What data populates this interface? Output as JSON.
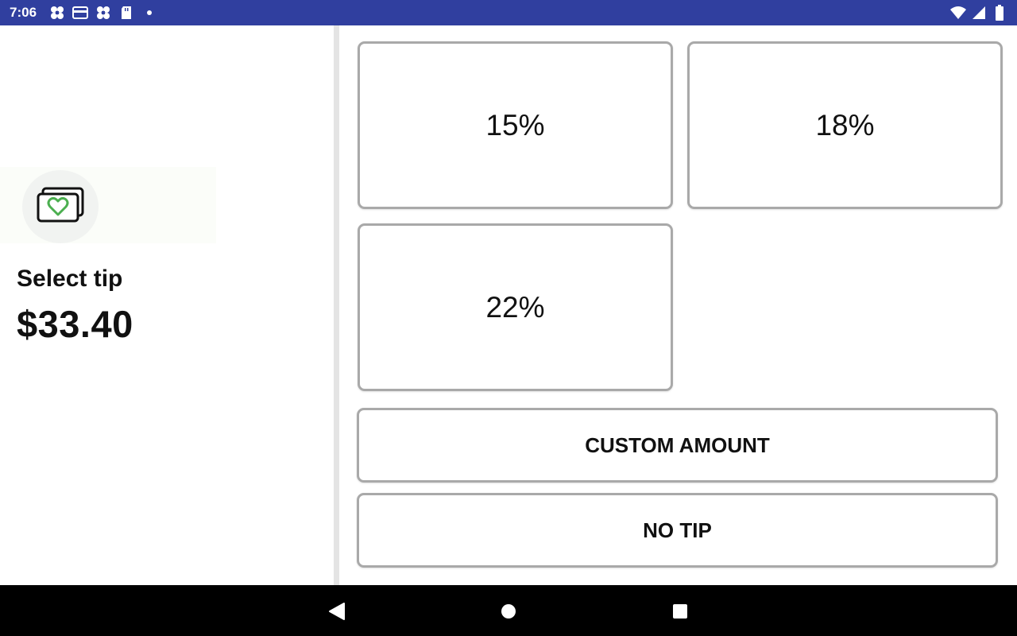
{
  "status_bar": {
    "time": "7:06",
    "left_icons": [
      "app-icon",
      "card-icon",
      "app-icon",
      "sd-card-icon",
      "dot-icon"
    ],
    "right_icons": [
      "wifi-icon",
      "signal-icon",
      "battery-icon"
    ],
    "background": "#303f9f"
  },
  "left": {
    "icon": "tip-cash-heart-icon",
    "title": "Select tip",
    "amount": "$33.40",
    "accent": "#4caf50"
  },
  "tips": {
    "options": [
      "15%",
      "18%",
      "22%"
    ],
    "custom_label": "CUSTOM AMOUNT",
    "no_tip_label": "NO TIP"
  },
  "nav": {
    "buttons": [
      "back-icon",
      "home-icon",
      "recents-icon"
    ]
  }
}
